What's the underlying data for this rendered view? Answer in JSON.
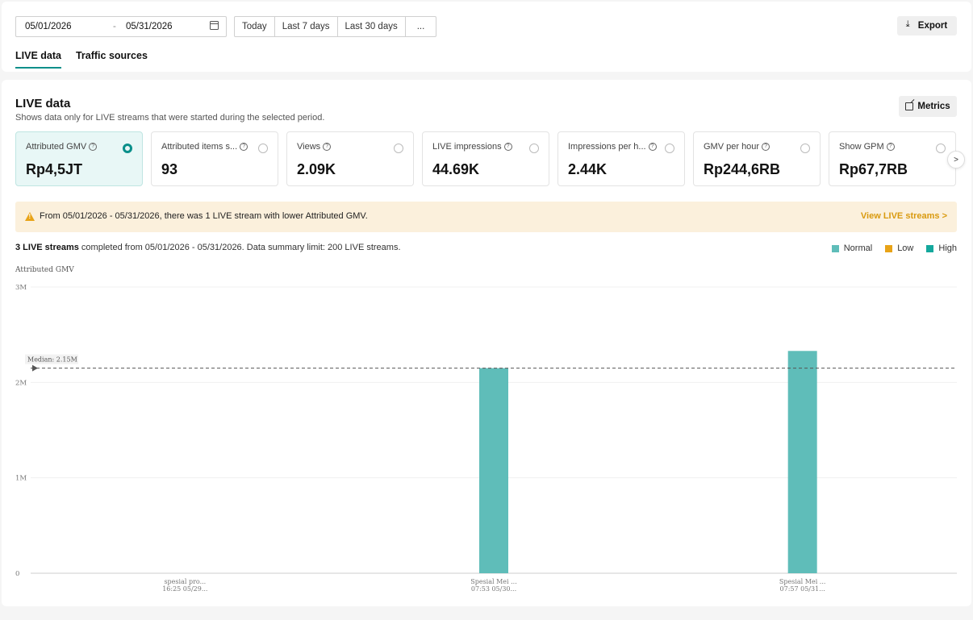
{
  "filters": {
    "start_date": "05/01/2026",
    "separator": "-",
    "end_date": "05/31/2026",
    "quick_ranges": [
      "Today",
      "Last 7 days",
      "Last 30 days",
      "..."
    ],
    "export_label": "Export"
  },
  "tabs": [
    {
      "label": "LIVE data",
      "active": true
    },
    {
      "label": "Traffic sources",
      "active": false
    }
  ],
  "section": {
    "title": "LIVE data",
    "subtitle": "Shows data only for LIVE streams that were started during the selected period.",
    "metrics_label": "Metrics"
  },
  "metric_cards": [
    {
      "label": "Attributed GMV",
      "value": "Rp4,5JT",
      "selected": true
    },
    {
      "label": "Attributed items s...",
      "value": "93",
      "selected": false
    },
    {
      "label": "Views",
      "value": "2.09K",
      "selected": false
    },
    {
      "label": "LIVE impressions",
      "value": "44.69K",
      "selected": false
    },
    {
      "label": "Impressions per h...",
      "value": "2.44K",
      "selected": false
    },
    {
      "label": "GMV per hour",
      "value": "Rp244,6RB",
      "selected": false
    },
    {
      "label": "Show GPM",
      "value": "Rp67,7RB",
      "selected": false
    }
  ],
  "next_icon": ">",
  "banner": {
    "text": "From 05/01/2026 - 05/31/2026, there was 1 LIVE stream with lower Attributed GMV.",
    "link": "View LIVE streams >"
  },
  "summary": {
    "bold": "3 LIVE streams",
    "rest": " completed from 05/01/2026 - 05/31/2026. Data summary limit: 200 LIVE streams."
  },
  "legend": [
    {
      "label": "Normal",
      "color": "#5fbdb9"
    },
    {
      "label": "Low",
      "color": "#e8a317"
    },
    {
      "label": "High",
      "color": "#14a89d"
    }
  ],
  "chart_data": {
    "type": "bar",
    "ylabel": "Attributed GMV",
    "ylim": [
      0,
      3000000
    ],
    "yticks": [
      {
        "value": 0,
        "label": "0"
      },
      {
        "value": 1000000,
        "label": "1M"
      },
      {
        "value": 2000000,
        "label": "2M"
      },
      {
        "value": 3000000,
        "label": "3M"
      }
    ],
    "median": {
      "value": 2150000,
      "label": "Median: 2.15M"
    },
    "categories": [
      {
        "line1": "spesial pro...",
        "line2": "16:25 05/29..."
      },
      {
        "line1": "Spesial Mei ...",
        "line2": "07:53 05/30..."
      },
      {
        "line1": "Spesial Mei ...",
        "line2": "07:57 05/31..."
      }
    ],
    "values": [
      0,
      2150000,
      2330000
    ],
    "bar_color": "#5fbdb9",
    "grid": true
  }
}
